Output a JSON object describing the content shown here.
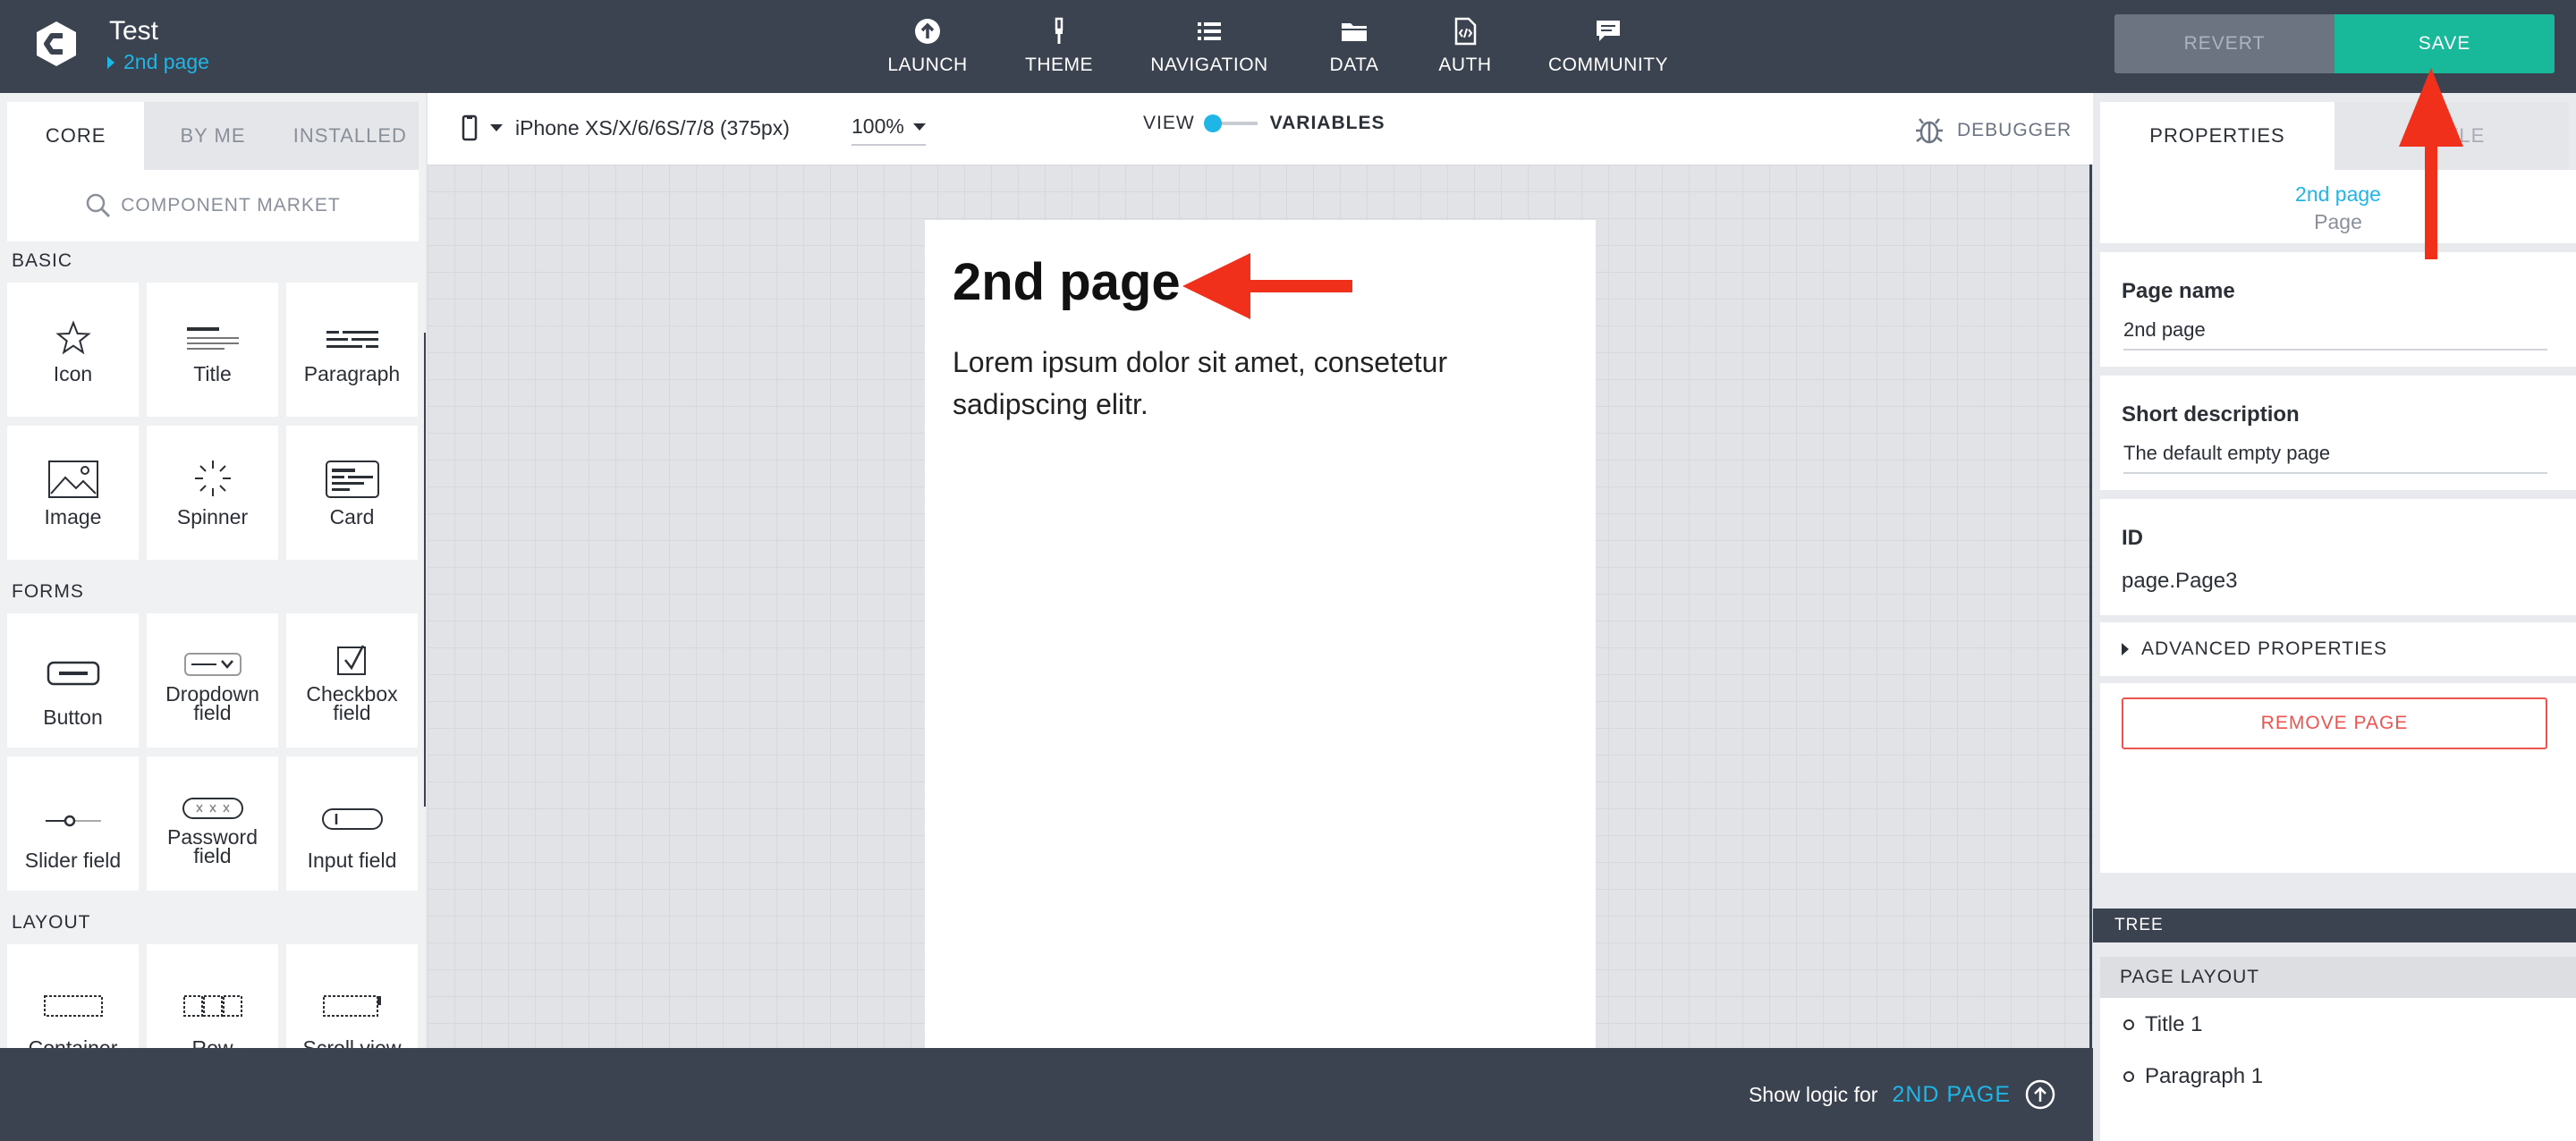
{
  "app": {
    "title": "Test",
    "current_page": "2nd page"
  },
  "nav": [
    {
      "label": "LAUNCH",
      "icon": "upload-icon"
    },
    {
      "label": "THEME",
      "icon": "brush-icon"
    },
    {
      "label": "NAVIGATION",
      "icon": "list-icon"
    },
    {
      "label": "DATA",
      "icon": "folder-icon"
    },
    {
      "label": "AUTH",
      "icon": "code-doc-icon"
    },
    {
      "label": "COMMUNITY",
      "icon": "chat-icon"
    }
  ],
  "actions": {
    "revert": "REVERT",
    "save": "SAVE"
  },
  "left": {
    "tabs": [
      "CORE",
      "BY ME",
      "INSTALLED"
    ],
    "market": "COMPONENT MARKET",
    "sections": {
      "basic": "BASIC",
      "forms": "FORMS",
      "layout": "LAYOUT"
    },
    "basic_items": [
      "Icon",
      "Title",
      "Paragraph",
      "Image",
      "Spinner",
      "Card"
    ],
    "form_items": [
      "Button",
      "Dropdown field",
      "Checkbox field",
      "Slider field",
      "Password field",
      "Input field"
    ],
    "layout_items": [
      "Container",
      "Row",
      "Scroll view"
    ]
  },
  "toolbar": {
    "device": "iPhone XS/X/6/6S/7/8 (375px)",
    "zoom": "100%",
    "view": "VIEW",
    "variables": "VARIABLES",
    "debugger": "DEBUGGER"
  },
  "page": {
    "title": "2nd page",
    "paragraph": "Lorem ipsum dolor sit amet, consetetur sadipscing elitr."
  },
  "bottom": {
    "logic_label": "Show logic for",
    "logic_page": "2ND PAGE"
  },
  "right": {
    "tabs": [
      "PROPERTIES",
      "STYLE"
    ],
    "header_title": "2nd page",
    "header_sub": "Page",
    "page_name_label": "Page name",
    "page_name_value": "2nd page",
    "short_desc_label": "Short description",
    "short_desc_value": "The default empty page",
    "id_label": "ID",
    "id_value": "page.Page3",
    "advanced": "ADVANCED PROPERTIES",
    "remove": "REMOVE PAGE",
    "tree_header": "TREE",
    "tree_root": "PAGE LAYOUT",
    "tree_items": [
      "Title 1",
      "Paragraph 1"
    ]
  },
  "colors": {
    "topbar": "#3c4350",
    "accent": "#1fb6e6",
    "save": "#17b99a",
    "remove": "#ef5350",
    "annotation_arrow": "#f0301a"
  }
}
